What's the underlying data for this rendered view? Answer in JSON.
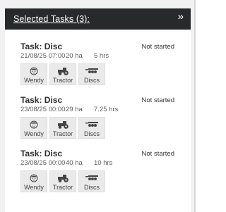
{
  "header": {
    "title": "Selected Tasks (3):",
    "collapse_icon": "»"
  },
  "tasks": [
    {
      "title": "Task: Disc",
      "date": "21/08/25 07:00",
      "area": "20 ha",
      "duration": "5 hrs",
      "status": "Not started",
      "resources": [
        {
          "icon": "person-icon",
          "label": "Wendy"
        },
        {
          "icon": "tractor-icon",
          "label": "Tractor"
        },
        {
          "icon": "disc-harrow-icon",
          "label": "Discs"
        }
      ]
    },
    {
      "title": "Task: Disc",
      "date": "23/08/25 00:00",
      "area": "29 ha",
      "duration": "7.25 hrs",
      "status": "Not started",
      "resources": [
        {
          "icon": "person-icon",
          "label": "Wendy"
        },
        {
          "icon": "tractor-icon",
          "label": "Tractor"
        },
        {
          "icon": "disc-harrow-icon",
          "label": "Discs"
        }
      ]
    },
    {
      "title": "Task: Disc",
      "date": "23/08/25 00:00",
      "area": "40 ha",
      "duration": "10 hrs",
      "status": "Not started",
      "resources": [
        {
          "icon": "person-icon",
          "label": "Wendy"
        },
        {
          "icon": "tractor-icon",
          "label": "Tractor"
        },
        {
          "icon": "disc-harrow-icon",
          "label": "Discs"
        }
      ]
    }
  ]
}
